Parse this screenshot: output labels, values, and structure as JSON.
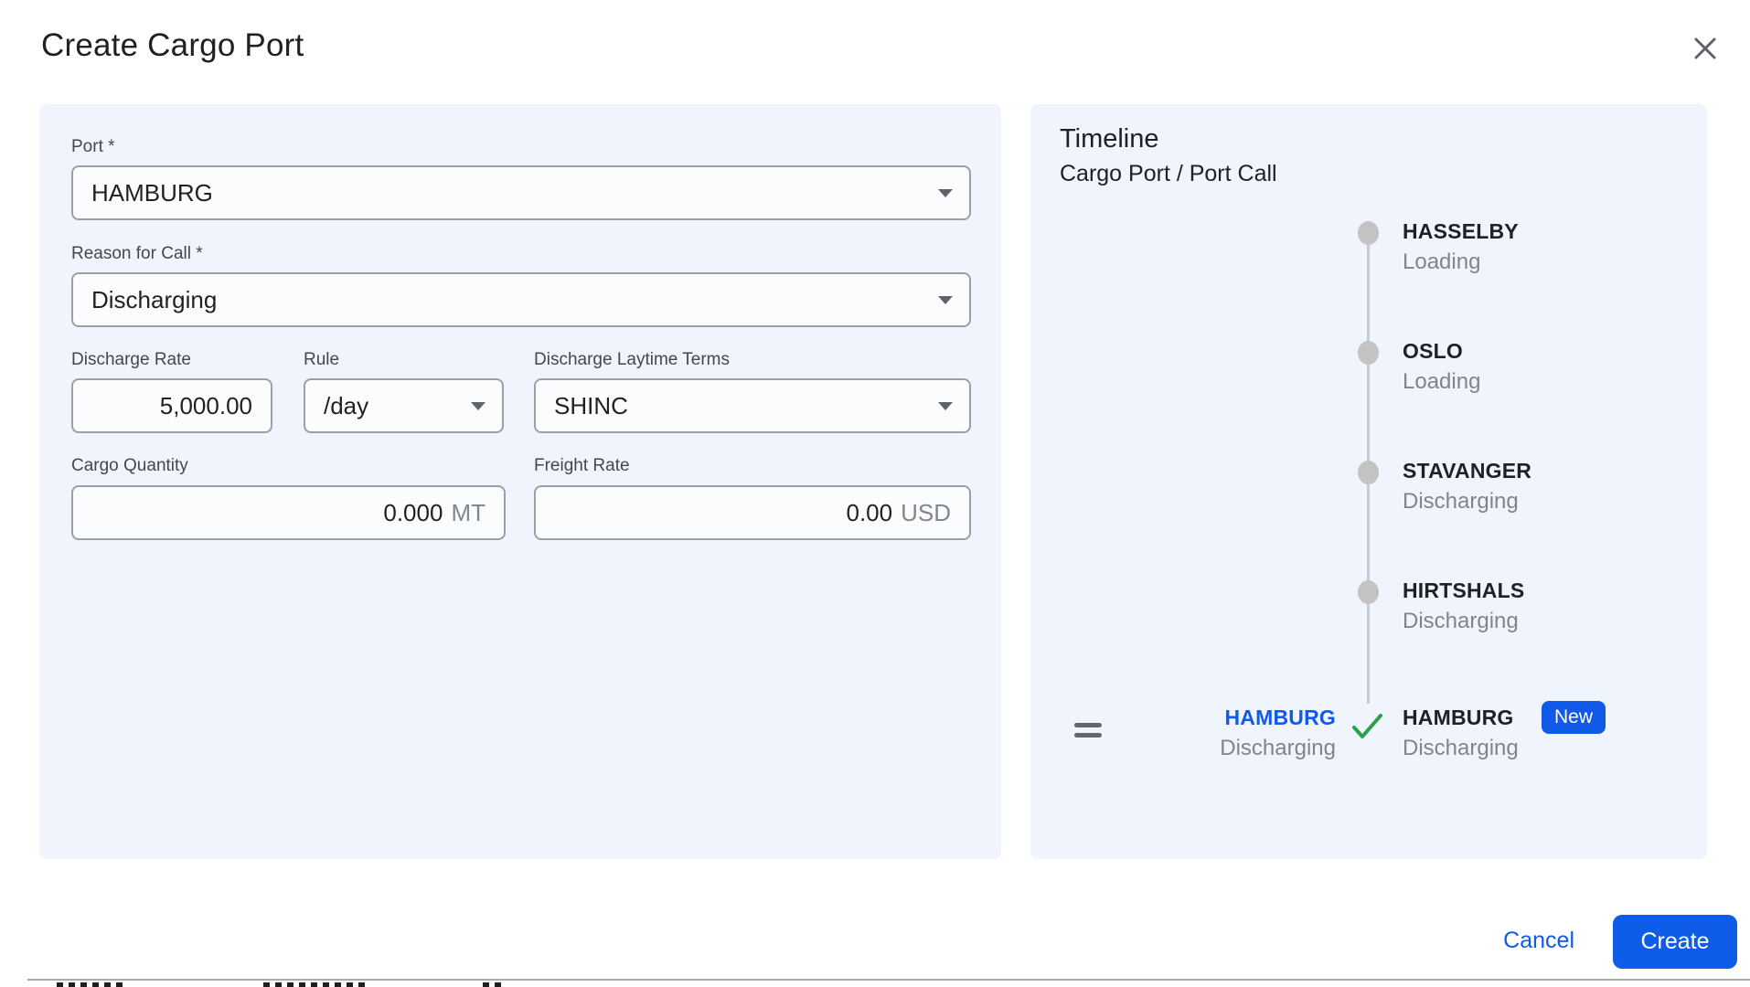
{
  "dialog": {
    "title": "Create Cargo Port"
  },
  "form": {
    "port": {
      "label": "Port *",
      "value": "HAMBURG"
    },
    "reason": {
      "label": "Reason for Call *",
      "value": "Discharging"
    },
    "discharge_rate": {
      "label": "Discharge Rate",
      "value": "5,000.00"
    },
    "rule": {
      "label": "Rule",
      "value": "/day"
    },
    "laytime": {
      "label": "Discharge Laytime Terms",
      "value": "SHINC"
    },
    "cargo_quantity": {
      "label": "Cargo Quantity",
      "value": "0.000",
      "unit": "MT"
    },
    "freight_rate": {
      "label": "Freight Rate",
      "value": "0.00",
      "unit": "USD"
    }
  },
  "timeline": {
    "title": "Timeline",
    "subtitle": "Cargo Port / Port Call",
    "entries": [
      {
        "port": "HASSELBY",
        "status": "Loading"
      },
      {
        "port": "OSLO",
        "status": "Loading"
      },
      {
        "port": "STAVANGER",
        "status": "Discharging"
      },
      {
        "port": "HIRTSHALS",
        "status": "Discharging"
      }
    ],
    "new_entry": {
      "cargo_port": "HAMBURG",
      "cargo_port_status": "Discharging",
      "port_call": "HAMBURG",
      "port_call_status": "Discharging",
      "badge": "New"
    }
  },
  "footer": {
    "cancel_label": "Cancel",
    "create_label": "Create"
  },
  "colors": {
    "accent_blue": "#1159e9",
    "success_green": "#2aa24c",
    "panel_bg": "#f0f4fc"
  }
}
